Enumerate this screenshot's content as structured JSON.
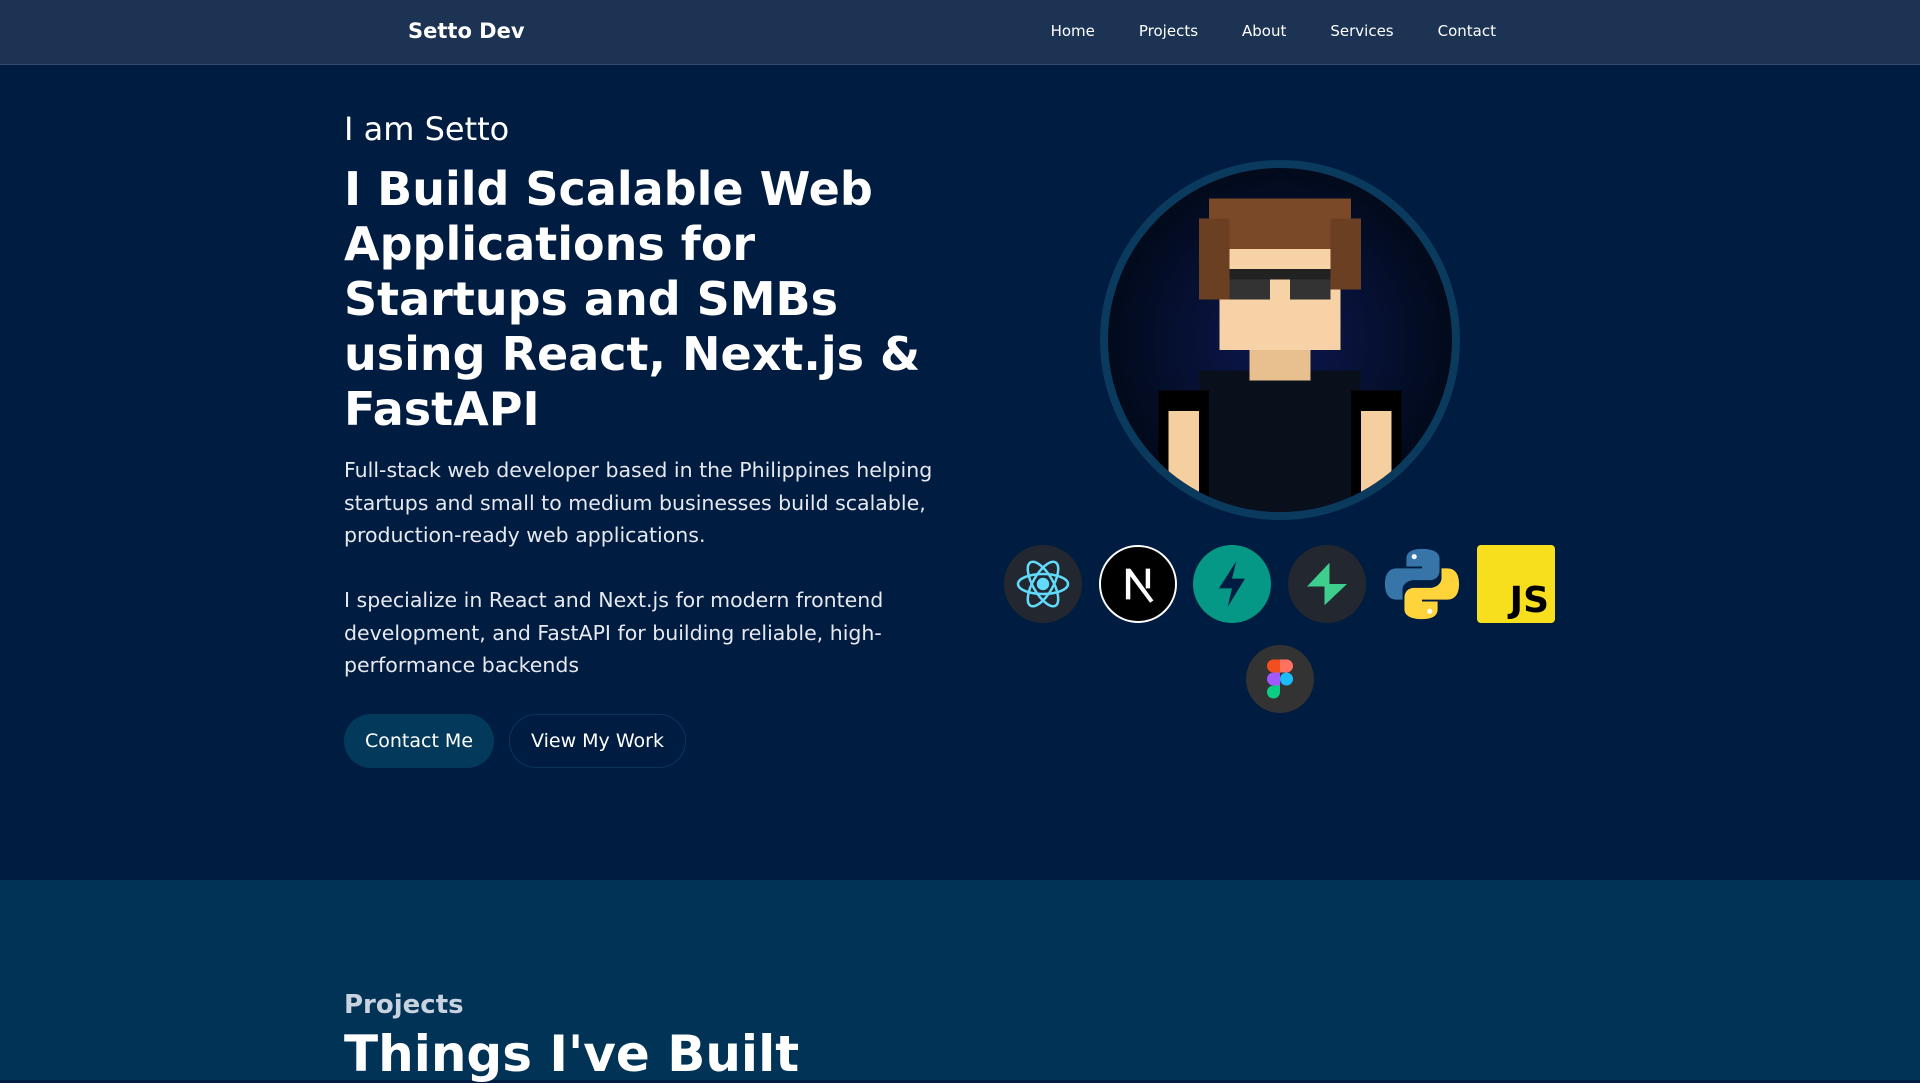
{
  "nav": {
    "brand": "Setto Dev",
    "links": [
      "Home",
      "Projects",
      "About",
      "Services",
      "Contact"
    ]
  },
  "hero": {
    "intro": "I am Setto",
    "headline": "I Build Scalable Web Applications for Startups and SMBs using React, Next.js & FastAPI",
    "paragraph1": "Full-stack web developer based in the Philippines helping startups and small to medium businesses build scalable, production-ready web applications.",
    "paragraph2": "I specialize in React and Next.js for modern frontend development, and FastAPI for building reliable, high-performance backends",
    "contact_button": "Contact Me",
    "work_button": "View My Work",
    "tech_icons": [
      "react-icon",
      "nextjs-icon",
      "fastapi-icon",
      "supabase-icon",
      "python-icon",
      "javascript-icon",
      "figma-icon"
    ],
    "js_label": "JS"
  },
  "projects": {
    "kicker": "Projects",
    "title": "Things I've Built"
  },
  "colors": {
    "nav": "#1c3354",
    "hero": "#001c40",
    "section": "#003356",
    "button": "#033a5c"
  }
}
